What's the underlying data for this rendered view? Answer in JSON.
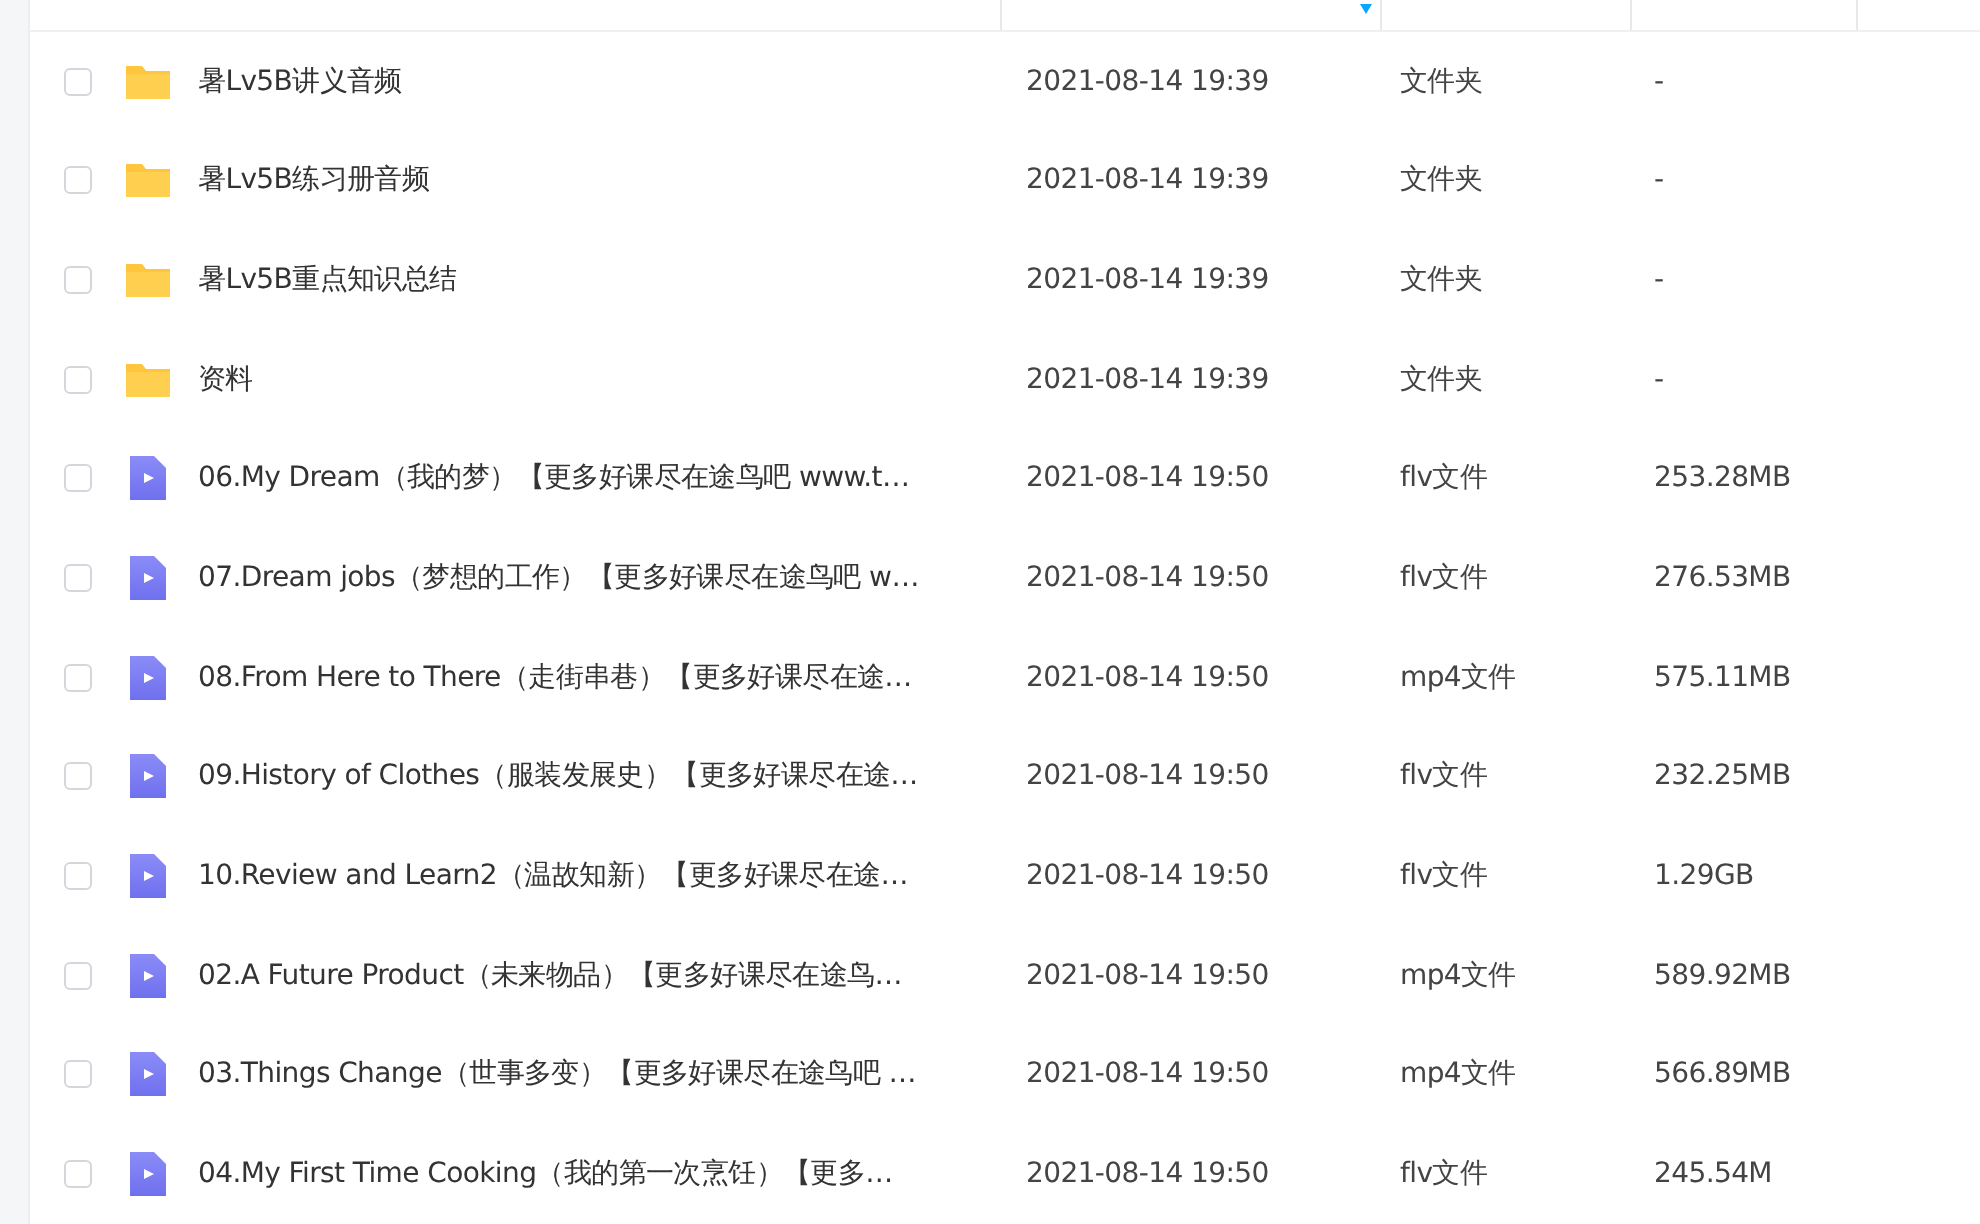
{
  "files": [
    {
      "kind": "folder",
      "checked": false,
      "name": "暑Lv5B讲义音频",
      "modified": "2021-08-14 19:39",
      "type": "文件夹",
      "size": "-"
    },
    {
      "kind": "folder",
      "checked": false,
      "name": "暑Lv5B练习册音频",
      "modified": "2021-08-14 19:39",
      "type": "文件夹",
      "size": "-"
    },
    {
      "kind": "folder",
      "checked": false,
      "name": "暑Lv5B重点知识总结",
      "modified": "2021-08-14 19:39",
      "type": "文件夹",
      "size": "-"
    },
    {
      "kind": "folder",
      "checked": false,
      "name": "资料",
      "modified": "2021-08-14 19:39",
      "type": "文件夹",
      "size": "-"
    },
    {
      "kind": "video",
      "checked": false,
      "name": "06.My Dream（我的梦）【更多好课尽在途鸟吧 www.t…",
      "modified": "2021-08-14 19:50",
      "type": "flv文件",
      "size": "253.28MB"
    },
    {
      "kind": "video",
      "checked": false,
      "name": "07.Dream jobs（梦想的工作）【更多好课尽在途鸟吧 w…",
      "modified": "2021-08-14 19:50",
      "type": "flv文件",
      "size": "276.53MB"
    },
    {
      "kind": "video",
      "checked": false,
      "name": "08.From Here to There（走街串巷）【更多好课尽在途…",
      "modified": "2021-08-14 19:50",
      "type": "mp4文件",
      "size": "575.11MB"
    },
    {
      "kind": "video",
      "checked": false,
      "name": "09.History of Clothes（服装发展史）【更多好课尽在途…",
      "modified": "2021-08-14 19:50",
      "type": "flv文件",
      "size": "232.25MB"
    },
    {
      "kind": "video",
      "checked": false,
      "name": "10.Review and Learn2（温故知新）【更多好课尽在途…",
      "modified": "2021-08-14 19:50",
      "type": "flv文件",
      "size": "1.29GB"
    },
    {
      "kind": "video",
      "checked": false,
      "name": "02.A Future Product（未来物品）【更多好课尽在途鸟…",
      "modified": "2021-08-14 19:50",
      "type": "mp4文件",
      "size": "589.92MB"
    },
    {
      "kind": "video",
      "checked": false,
      "name": "03.Things Change（世事多变）【更多好课尽在途鸟吧 …",
      "modified": "2021-08-14 19:50",
      "type": "mp4文件",
      "size": "566.89MB"
    },
    {
      "kind": "video",
      "checked": false,
      "name": "04.My First Time Cooking（我的第一次烹饪）【更多…",
      "modified": "2021-08-14 19:50",
      "type": "flv文件",
      "size": "245.54M"
    }
  ]
}
